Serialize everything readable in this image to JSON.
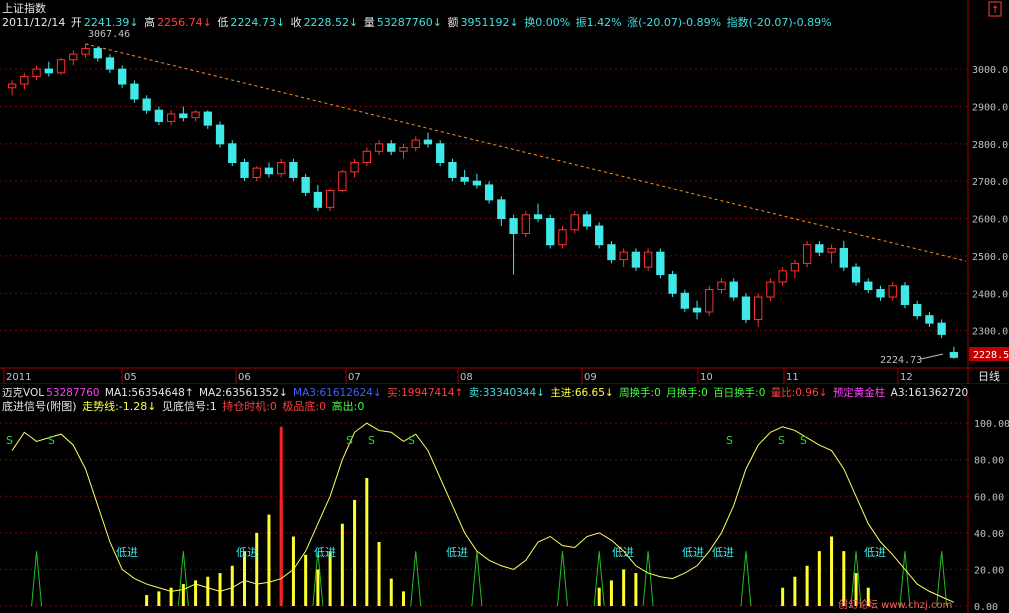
{
  "header": {
    "title": "上证指数",
    "date": "2011/12/14",
    "open_label": "开",
    "open": "2241.39↓",
    "high_label": "高",
    "high": "2256.74↓",
    "low_label": "低",
    "low": "2224.73↓",
    "close_label": "收",
    "close": "2228.52↓",
    "vol_label": "量",
    "vol": "53287760↓",
    "amt_label": "额",
    "amt": "3951192↓",
    "turnover": "换0.00%",
    "amplitude": "振1.42%",
    "change": "涨(-20.07)-0.89%",
    "index_change": "指数(-20.07)-0.89%"
  },
  "main": {
    "peak_label": "3067.46",
    "low_label": "2224.73",
    "current_price": "2228.5",
    "y_ticks": [
      "3000.0",
      "2900.0",
      "2800.0",
      "2700.0",
      "2600.0",
      "2500.0",
      "2400.0",
      "2300.0"
    ],
    "x_ticks": [
      "2011",
      "05",
      "06",
      "07",
      "08",
      "09",
      "10",
      "11",
      "12"
    ],
    "period_label": "日线"
  },
  "vol_bar": {
    "name": "迈克VOL",
    "value": "53287760",
    "ma1": "MA1:56354648↑",
    "ma2": "MA2:63561352↓",
    "ma3": "MA3:61612624↓",
    "buy": "买:19947414↑",
    "sell": "卖:33340344↓",
    "main_in": "主进:66.65↓",
    "week_turn": "周换手:0",
    "month_turn": "月换手:0",
    "hundred_turn": "百日换手:0",
    "vol_ratio": "量比:0.96↓",
    "gold": "预定黄金柱",
    "a3": "A3:161362720"
  },
  "sub": {
    "name": "底进信号(附图)",
    "trend": "走势线:-1.28↓",
    "signal": "见底信号:1",
    "hold": "持仓时机:0",
    "extreme": "极品底:0",
    "high_out": "高出:0",
    "y_ticks": [
      "100.00",
      "80.00",
      "60.00",
      "40.00",
      "20.00",
      "0.00"
    ],
    "s_marker": "S",
    "buy_marker": "低进",
    "watermark": "创幻论坛 www.chzj.com"
  },
  "chart_data": {
    "type": "candlestick",
    "main_ylim": [
      2200,
      3110
    ],
    "candles": [
      [
        2950,
        2970,
        2930,
        2960
      ],
      [
        2960,
        2990,
        2945,
        2980
      ],
      [
        2980,
        3010,
        2970,
        3000
      ],
      [
        3000,
        3020,
        2980,
        2990
      ],
      [
        2990,
        3030,
        2985,
        3025
      ],
      [
        3025,
        3050,
        3010,
        3040
      ],
      [
        3040,
        3067.46,
        3030,
        3055
      ],
      [
        3055,
        3060,
        3020,
        3030
      ],
      [
        3030,
        3040,
        2990,
        3000
      ],
      [
        3000,
        3010,
        2950,
        2960
      ],
      [
        2960,
        2970,
        2910,
        2920
      ],
      [
        2920,
        2930,
        2880,
        2890
      ],
      [
        2890,
        2900,
        2850,
        2860
      ],
      [
        2860,
        2890,
        2850,
        2880
      ],
      [
        2880,
        2900,
        2860,
        2870
      ],
      [
        2870,
        2890,
        2860,
        2885
      ],
      [
        2885,
        2890,
        2840,
        2850
      ],
      [
        2850,
        2860,
        2790,
        2800
      ],
      [
        2800,
        2810,
        2740,
        2750
      ],
      [
        2750,
        2760,
        2700,
        2710
      ],
      [
        2710,
        2740,
        2700,
        2735
      ],
      [
        2735,
        2750,
        2710,
        2720
      ],
      [
        2720,
        2760,
        2710,
        2750
      ],
      [
        2750,
        2760,
        2700,
        2710
      ],
      [
        2710,
        2720,
        2660,
        2670
      ],
      [
        2670,
        2690,
        2620,
        2630
      ],
      [
        2630,
        2680,
        2620,
        2675
      ],
      [
        2675,
        2730,
        2670,
        2725
      ],
      [
        2725,
        2760,
        2710,
        2750
      ],
      [
        2750,
        2790,
        2740,
        2780
      ],
      [
        2780,
        2810,
        2770,
        2800
      ],
      [
        2800,
        2810,
        2770,
        2780
      ],
      [
        2780,
        2800,
        2760,
        2790
      ],
      [
        2790,
        2820,
        2780,
        2810
      ],
      [
        2810,
        2830,
        2790,
        2800
      ],
      [
        2800,
        2810,
        2740,
        2750
      ],
      [
        2750,
        2760,
        2700,
        2710
      ],
      [
        2710,
        2730,
        2690,
        2700
      ],
      [
        2700,
        2720,
        2680,
        2690
      ],
      [
        2690,
        2700,
        2640,
        2650
      ],
      [
        2650,
        2660,
        2580,
        2600
      ],
      [
        2600,
        2610,
        2450,
        2560
      ],
      [
        2560,
        2620,
        2550,
        2610
      ],
      [
        2610,
        2640,
        2590,
        2600
      ],
      [
        2600,
        2610,
        2520,
        2530
      ],
      [
        2530,
        2580,
        2520,
        2570
      ],
      [
        2570,
        2620,
        2560,
        2610
      ],
      [
        2610,
        2620,
        2570,
        2580
      ],
      [
        2580,
        2590,
        2520,
        2530
      ],
      [
        2530,
        2540,
        2480,
        2490
      ],
      [
        2490,
        2520,
        2470,
        2510
      ],
      [
        2510,
        2520,
        2460,
        2470
      ],
      [
        2470,
        2520,
        2460,
        2510
      ],
      [
        2510,
        2520,
        2440,
        2450
      ],
      [
        2450,
        2460,
        2390,
        2400
      ],
      [
        2400,
        2410,
        2350,
        2360
      ],
      [
        2360,
        2380,
        2330,
        2350
      ],
      [
        2350,
        2420,
        2340,
        2410
      ],
      [
        2410,
        2440,
        2400,
        2430
      ],
      [
        2430,
        2440,
        2380,
        2390
      ],
      [
        2390,
        2400,
        2320,
        2330
      ],
      [
        2330,
        2400,
        2310,
        2390
      ],
      [
        2390,
        2440,
        2380,
        2430
      ],
      [
        2430,
        2470,
        2420,
        2460
      ],
      [
        2460,
        2490,
        2440,
        2480
      ],
      [
        2480,
        2540,
        2470,
        2530
      ],
      [
        2530,
        2540,
        2500,
        2510
      ],
      [
        2510,
        2530,
        2480,
        2520
      ],
      [
        2520,
        2540,
        2460,
        2470
      ],
      [
        2470,
        2480,
        2420,
        2430
      ],
      [
        2430,
        2440,
        2400,
        2410
      ],
      [
        2410,
        2420,
        2380,
        2390
      ],
      [
        2390,
        2430,
        2380,
        2420
      ],
      [
        2420,
        2430,
        2360,
        2370
      ],
      [
        2370,
        2380,
        2330,
        2340
      ],
      [
        2340,
        2350,
        2310,
        2320
      ],
      [
        2320,
        2330,
        2280,
        2290
      ],
      [
        2241.39,
        2256.74,
        2224.73,
        2228.52
      ]
    ],
    "trendline": {
      "from": [
        3067.46,
        6
      ],
      "to": [
        2470,
        80
      ]
    },
    "sub_ylim": [
      0,
      105
    ],
    "trend_line": [
      85,
      95,
      90,
      92,
      94,
      88,
      75,
      55,
      35,
      20,
      15,
      12,
      10,
      8,
      9,
      12,
      10,
      8,
      10,
      14,
      12,
      13,
      15,
      20,
      30,
      45,
      60,
      80,
      95,
      100,
      96,
      95,
      90,
      94,
      85,
      70,
      55,
      40,
      30,
      25,
      22,
      20,
      25,
      35,
      38,
      33,
      32,
      38,
      40,
      36,
      30,
      22,
      18,
      16,
      15,
      18,
      22,
      30,
      40,
      55,
      75,
      88,
      95,
      98,
      96,
      92,
      88,
      85,
      75,
      60,
      45,
      35,
      28,
      20,
      12,
      8,
      5,
      2
    ],
    "volume_bars": [
      0,
      0,
      0,
      0,
      0,
      0,
      0,
      0,
      0,
      0,
      0,
      6,
      8,
      10,
      12,
      14,
      16,
      18,
      22,
      30,
      40,
      50,
      58,
      38,
      28,
      20,
      30,
      45,
      58,
      70,
      35,
      15,
      8,
      0,
      0,
      0,
      0,
      0,
      0,
      0,
      0,
      0,
      0,
      0,
      0,
      0,
      0,
      0,
      10,
      14,
      20,
      18,
      0,
      0,
      0,
      0,
      0,
      0,
      0,
      0,
      0,
      0,
      0,
      10,
      16,
      22,
      30,
      38,
      30,
      18,
      10,
      0,
      0,
      0,
      0,
      0,
      0,
      0
    ],
    "signal_spikes": [
      2,
      14,
      25,
      33,
      38,
      45,
      48,
      52,
      60,
      69,
      73,
      76
    ]
  }
}
